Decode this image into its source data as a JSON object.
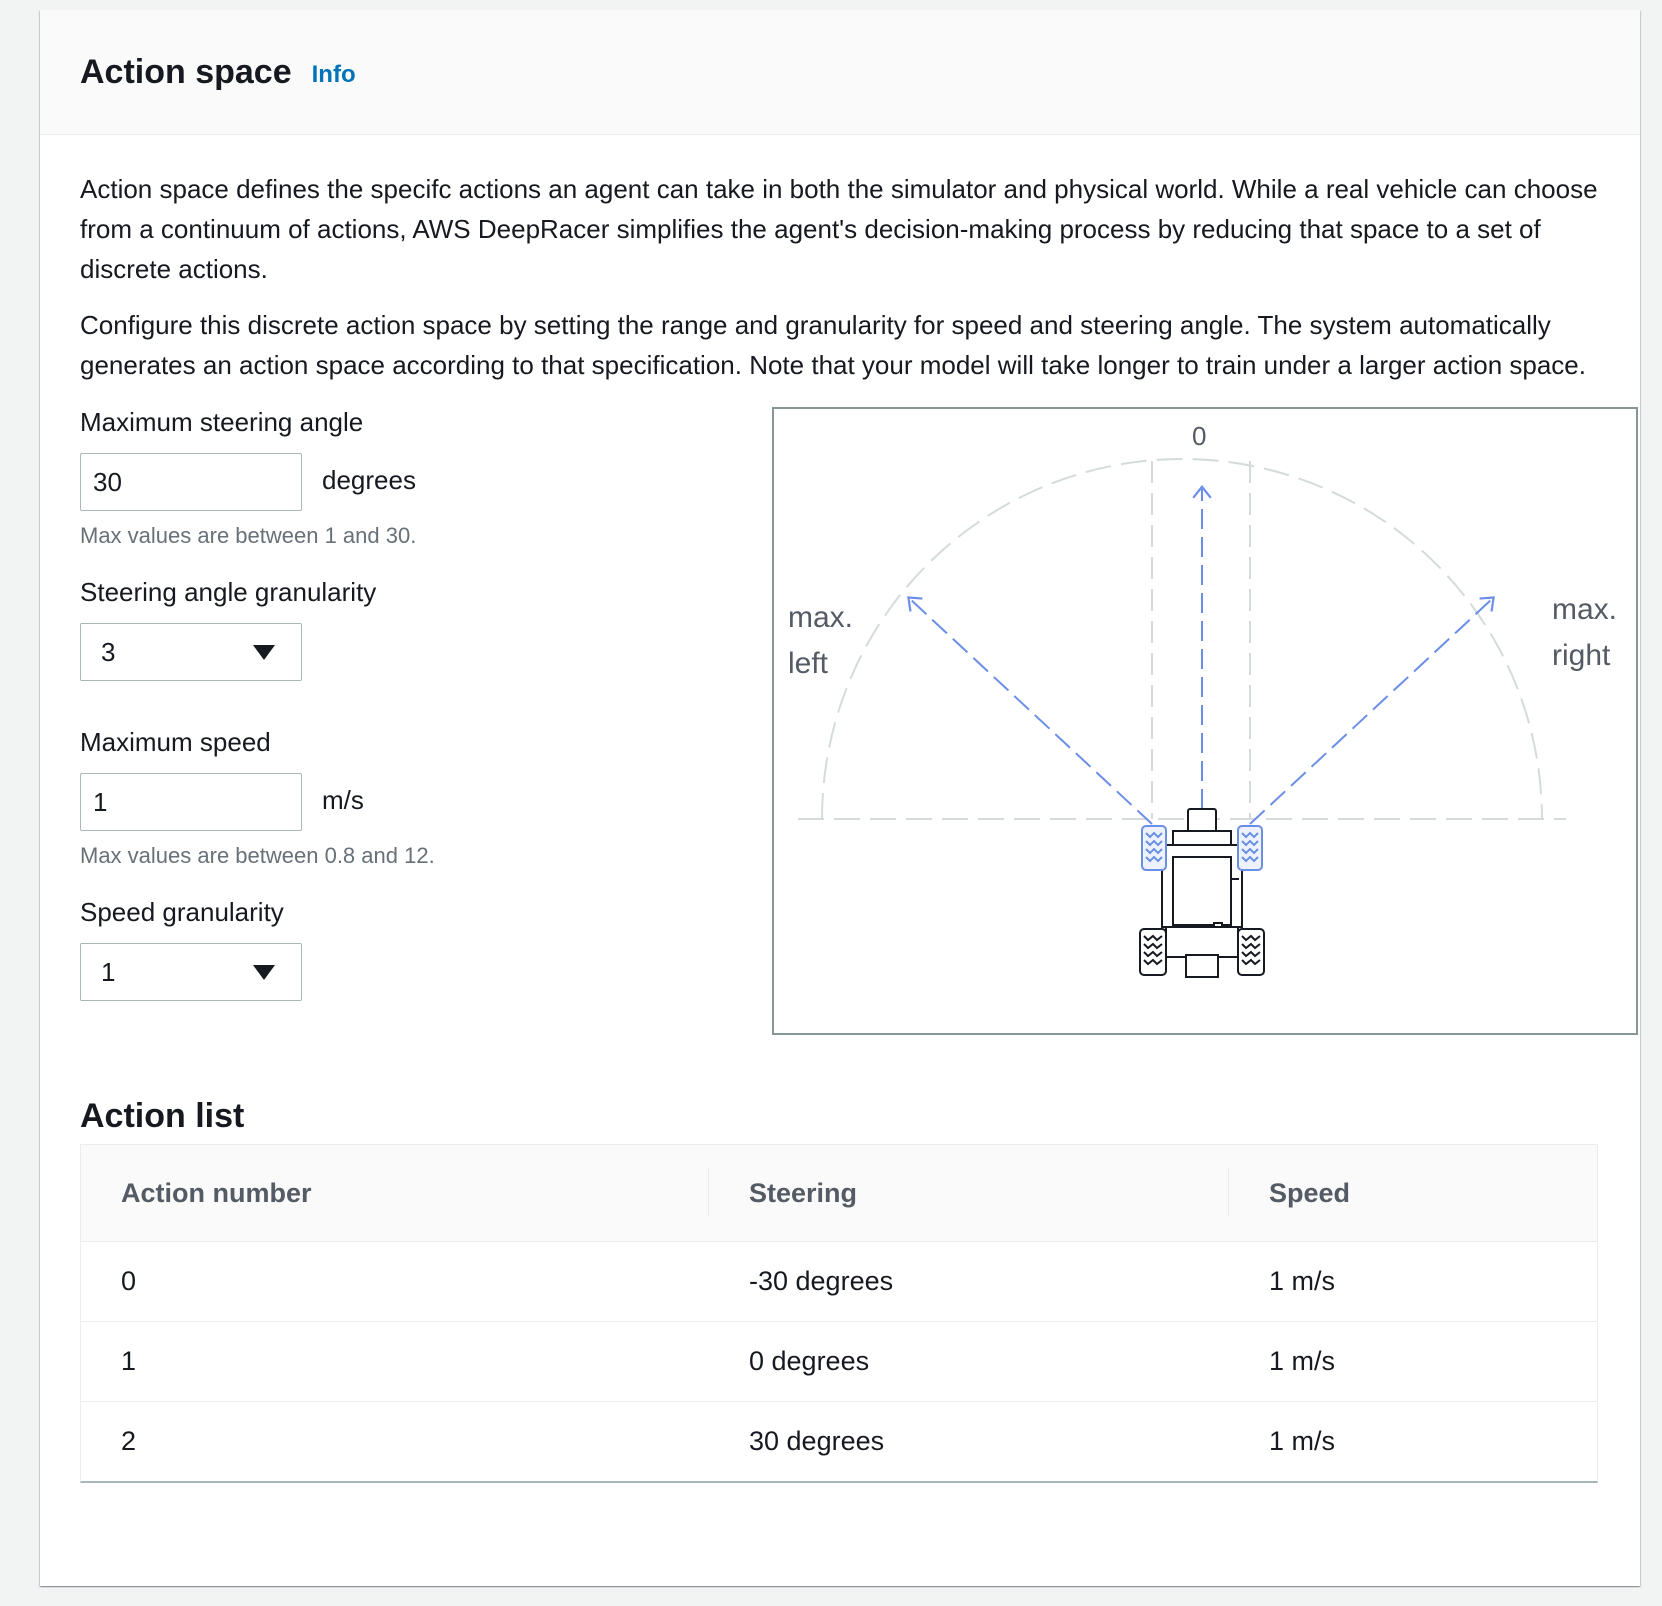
{
  "header": {
    "title": "Action space",
    "info_label": "Info"
  },
  "description": {
    "para1": "Action space defines the specifc actions an agent can take in both the simulator and physical world. While a real vehicle can choose from a continuum of actions, AWS DeepRacer simplifies the agent's decision-making process by reducing that space to a set of discrete actions.",
    "para2": "Configure this discrete action space by setting the range and granularity for speed and steering angle. The system automatically generates an action space according to that specification. Note that your model will take longer to train under a larger action space."
  },
  "form": {
    "max_steering": {
      "label": "Maximum steering angle",
      "value": "30",
      "unit": "degrees",
      "hint": "Max values are between 1 and 30."
    },
    "steering_granularity": {
      "label": "Steering angle granularity",
      "value": "3"
    },
    "max_speed": {
      "label": "Maximum speed",
      "value": "1",
      "unit": "m/s",
      "hint": "Max values are between 0.8 and 12."
    },
    "speed_granularity": {
      "label": "Speed granularity",
      "value": "1"
    }
  },
  "diagram": {
    "zero_label": "0",
    "left_line1": "max.",
    "left_line2": "left",
    "right_line1": "max.",
    "right_line2": "right",
    "arrow_color": "#6b8ee6",
    "guide_color": "#d5dbdb",
    "car_color": "#16191f"
  },
  "action_list": {
    "title": "Action list",
    "columns": [
      "Action number",
      "Steering",
      "Speed"
    ],
    "rows": [
      [
        "0",
        "-30 degrees",
        "1 m/s"
      ],
      [
        "1",
        "0 degrees",
        "1 m/s"
      ],
      [
        "2",
        "30 degrees",
        "1 m/s"
      ]
    ]
  }
}
